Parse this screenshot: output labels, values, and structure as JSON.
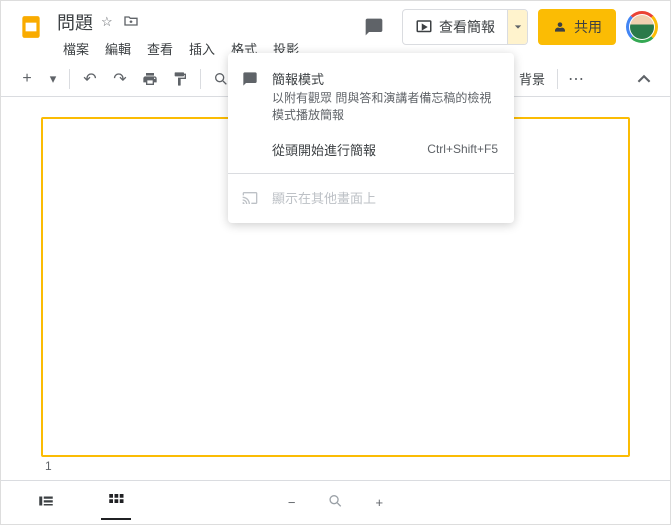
{
  "header": {
    "doc_title": "問題",
    "menubar": [
      "檔案",
      "編輯",
      "查看",
      "插入",
      "格式",
      "投影"
    ],
    "present_label": "查看簡報",
    "share_label": "共用"
  },
  "toolbar": {
    "background_label": "背景"
  },
  "dropdown": {
    "item1": {
      "title": "簡報模式",
      "desc": "以附有觀眾 問與答和演講者備忘稿的檢視模式播放簡報"
    },
    "item2": {
      "label": "從頭開始進行簡報",
      "shortcut": "Ctrl+Shift+F5"
    },
    "item3": {
      "label": "顯示在其他畫面上"
    }
  },
  "slide": {
    "number": "1"
  }
}
